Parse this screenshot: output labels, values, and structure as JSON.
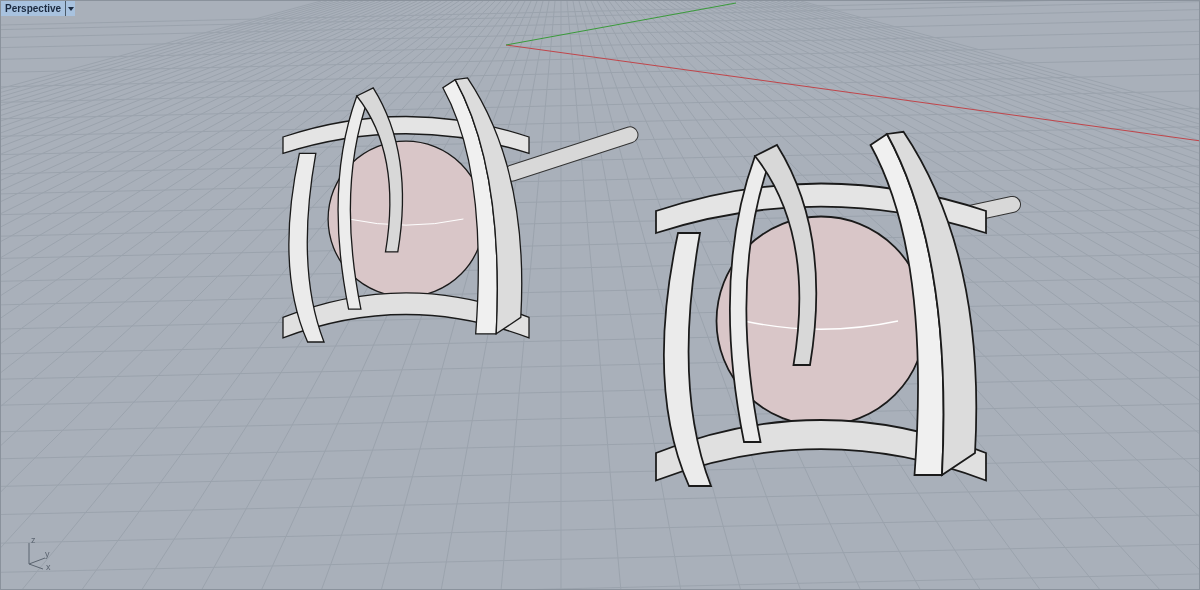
{
  "viewport": {
    "title": "Perspective",
    "active": true
  },
  "axis_icon": {
    "labels": [
      "z",
      "y",
      "x"
    ]
  }
}
